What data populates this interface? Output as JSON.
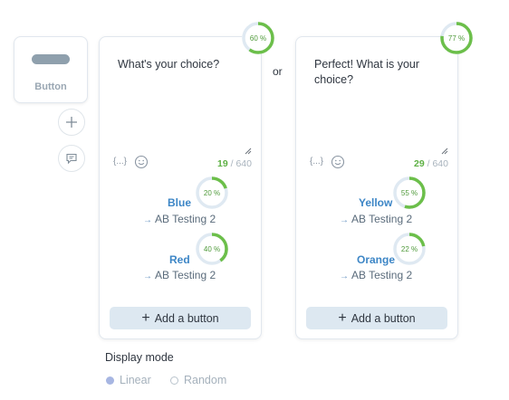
{
  "palette": {
    "block_label": "Button"
  },
  "connector_label": "or",
  "cards": [
    {
      "text": "What's your choice?",
      "percent_label": "60 %",
      "percent": 60,
      "counter_current": "19",
      "counter_sep_max": " / 640",
      "vars_token": "{...}",
      "choices": [
        {
          "name": "Blue",
          "target": "AB Testing 2",
          "percent_label": "20 %",
          "percent": 20
        },
        {
          "name": "Red",
          "target": "AB Testing 2",
          "percent_label": "40 %",
          "percent": 40
        }
      ],
      "add_button_label": "Add a button"
    },
    {
      "text": "Perfect! What is your choice?",
      "percent_label": "77 %",
      "percent": 77,
      "counter_current": "29",
      "counter_sep_max": " / 640",
      "vars_token": "{...}",
      "choices": [
        {
          "name": "Yellow",
          "target": "AB Testing 2",
          "percent_label": "55 %",
          "percent": 55
        },
        {
          "name": "Orange",
          "target": "AB Testing 2",
          "percent_label": "22 %",
          "percent": 22
        }
      ],
      "add_button_label": "Add a button"
    }
  ],
  "display_mode": {
    "title": "Display mode",
    "options": [
      {
        "label": "Linear",
        "selected": true
      },
      {
        "label": "Random",
        "selected": false
      }
    ]
  },
  "colors": {
    "ring_fill": "#6cbf4a",
    "ring_track": "#dfe9f2",
    "link_blue": "#3d86c6",
    "button_bg": "#dde8f1"
  }
}
